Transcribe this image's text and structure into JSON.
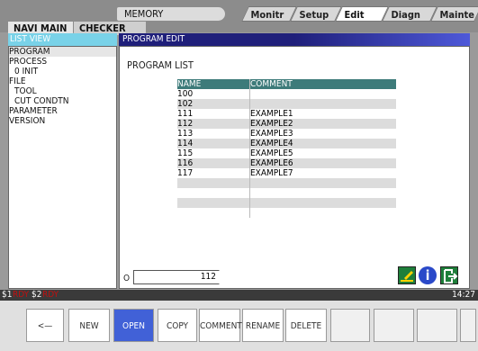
{
  "header": {
    "status": "MEMORY",
    "tabs": [
      {
        "label": "Monitr"
      },
      {
        "label": "Setup"
      },
      {
        "label": "Edit",
        "active": true
      },
      {
        "label": "Diagn"
      },
      {
        "label": "Mainte"
      }
    ],
    "nav_tabs": [
      {
        "label": "NAVI MAIN"
      },
      {
        "label": "CHECKER"
      }
    ]
  },
  "left": {
    "title": "LIST VIEW",
    "items": [
      {
        "label": "PROGRAM"
      },
      {
        "label": "PROCESS"
      },
      {
        "label": " 0 INIT"
      },
      {
        "label": "FILE"
      },
      {
        "label": " TOOL"
      },
      {
        "label": " CUT CONDTN"
      },
      {
        "label": "PARAMETER"
      },
      {
        "label": "VERSION"
      }
    ]
  },
  "main": {
    "title": "PROGRAM EDIT",
    "list_title": "PROGRAM LIST",
    "columns": [
      "NAME",
      "COMMENT"
    ],
    "rows": [
      {
        "name": "100",
        "comment": ""
      },
      {
        "name": "102",
        "comment": ""
      },
      {
        "name": "111",
        "comment": "EXAMPLE1"
      },
      {
        "name": "112",
        "comment": "EXAMPLE2"
      },
      {
        "name": "113",
        "comment": "EXAMPLE3"
      },
      {
        "name": "114",
        "comment": "EXAMPLE4"
      },
      {
        "name": "115",
        "comment": "EXAMPLE5"
      },
      {
        "name": "116",
        "comment": "EXAMPLE6"
      },
      {
        "name": "117",
        "comment": "EXAMPLE7"
      },
      {
        "name": "",
        "comment": ""
      },
      {
        "name": "",
        "comment": ""
      },
      {
        "name": "",
        "comment": ""
      },
      {
        "name": "",
        "comment": ""
      }
    ],
    "input_label": "O",
    "input_value": "112"
  },
  "status_bar": {
    "ch1": "$1",
    "ch1_state": "RDY",
    "ch2": "$2",
    "ch2_state": "RDY",
    "time": "14:27"
  },
  "softkeys": [
    {
      "label": "<—"
    },
    {
      "label": "NEW"
    },
    {
      "label": "OPEN"
    },
    {
      "label": "COPY"
    },
    {
      "label": "COMMENT"
    },
    {
      "label": "RENAME"
    },
    {
      "label": "DELETE"
    }
  ],
  "colors": {
    "accent_blue": "#4161d7",
    "header_gradient_dark": "#1f1f7a",
    "list_head_cyan": "#79d2e8",
    "table_head": "#3d7b7a",
    "rdy_red": "#c01010"
  }
}
